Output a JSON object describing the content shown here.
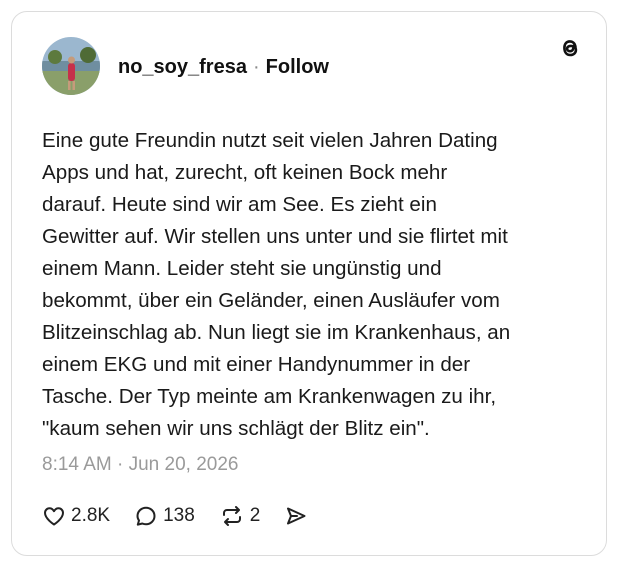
{
  "post": {
    "username": "no_soy_fresa",
    "separator": "·",
    "follow_label": "Follow",
    "text": "Eine gute Freundin nutzt seit vielen Jahren Dating\nApps und hat, zurecht, oft keinen Bock mehr\ndarauf. Heute sind wir am See. Es zieht ein\nGewitter auf. Wir stellen uns unter und sie flirtet mit\neinem Mann. Leider steht sie ungünstig und\nbekommt, über ein Geländer, einen Ausläufer vom\nBlitzeinschlag ab. Nun liegt sie im Krankenhaus, an\neinem EKG und mit einer Handynummer in der\nTasche. Der Typ meinte am Krankenwagen zu ihr,\n\"kaum sehen wir uns schlägt der Blitz ein\".",
    "timestamp": "8:14 AM · Jun 20, 2026"
  },
  "actions": {
    "likes": "2.8K",
    "replies": "138",
    "reposts": "2"
  },
  "icons": {
    "logo": "threads-icon",
    "like": "heart-icon",
    "reply": "speech-bubble-icon",
    "repost": "repost-icon",
    "share": "send-icon"
  }
}
